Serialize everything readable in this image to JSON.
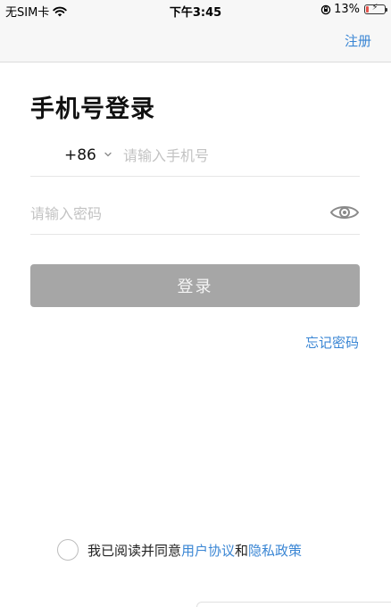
{
  "status_bar": {
    "carrier": "无SIM卡",
    "time": "下午3:45",
    "battery_percent": "13%",
    "battery_level": 0.13,
    "icons": [
      "wifi-icon",
      "orientation-lock-icon",
      "battery-charging-icon"
    ]
  },
  "nav": {
    "register_label": "注册"
  },
  "page": {
    "title": "手机号登录"
  },
  "phone": {
    "country_code": "+86",
    "placeholder": "请输入手机号",
    "value": ""
  },
  "password": {
    "placeholder": "请输入密码",
    "value": "",
    "visibility_icon": "eye-icon"
  },
  "login_button": {
    "label": "登录",
    "enabled": false
  },
  "forgot_password": {
    "label": "忘记密码"
  },
  "agreement": {
    "checked": false,
    "prefix": "我已阅读并同意",
    "user_agreement": "用户协议",
    "conjunction": "和",
    "privacy_policy": "隐私政策"
  },
  "colors": {
    "accent": "#3a86d4",
    "button_disabled": "#a6a6a6",
    "placeholder": "#c3c3c3",
    "battery_low": "#e5534b"
  }
}
